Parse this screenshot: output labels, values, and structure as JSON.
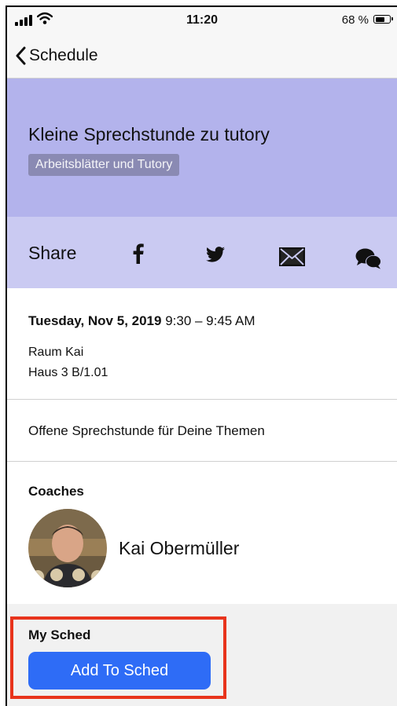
{
  "status_bar": {
    "time": "11:20",
    "battery": "68 %",
    "battery_level": 0.68
  },
  "nav": {
    "back_label": "Schedule"
  },
  "session": {
    "title": "Kleine Sprechstunde zu tutory",
    "track": "Arbeitsblätter und Tutory",
    "header_color": "#b3b3ec"
  },
  "share": {
    "label": "Share",
    "icons": [
      "facebook-icon",
      "twitter-icon",
      "mail-icon",
      "wechat-icon"
    ],
    "color": "#cacaf2"
  },
  "details": {
    "date": "Tuesday, Nov 5, 2019",
    "time": "9:30 – 9:45 AM",
    "room": "Raum Kai",
    "building": "Haus 3 B/1.01"
  },
  "description": "Offene Sprechstunde für Deine Themen",
  "coaches": {
    "heading": "Coaches",
    "items": [
      {
        "name": "Kai Obermüller"
      }
    ]
  },
  "my_sched": {
    "heading": "My Sched",
    "button_label": "Add To Sched",
    "button_color": "#2e6cf6",
    "highlight_color": "#e8341c"
  }
}
